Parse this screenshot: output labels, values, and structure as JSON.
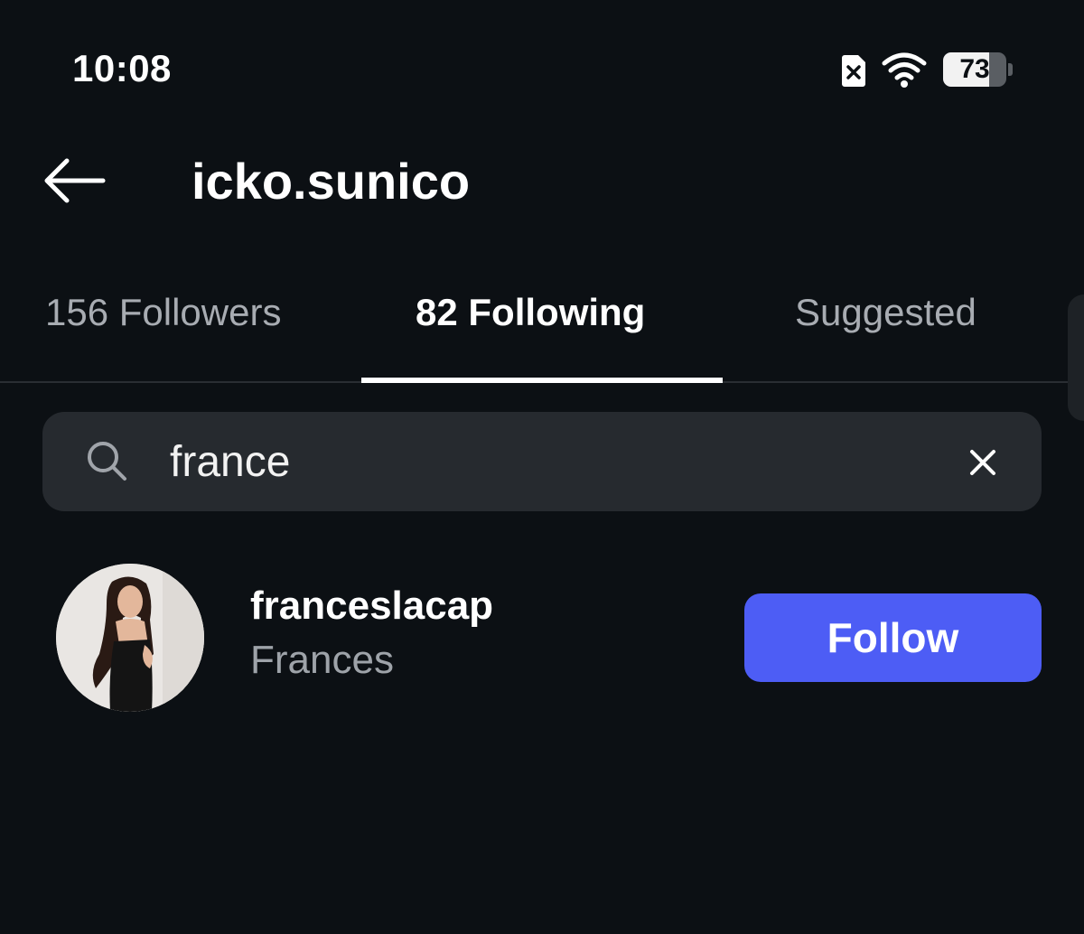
{
  "status_bar": {
    "time": "10:08",
    "battery_percent": 73,
    "battery_label": "73",
    "icons": [
      "sim-off-icon",
      "wifi-icon",
      "battery-icon"
    ]
  },
  "header": {
    "back_icon": "arrow-left-icon",
    "title": "icko.sunico"
  },
  "tabs": [
    {
      "label": "156 Followers",
      "active": false
    },
    {
      "label": "82 Following",
      "active": true
    },
    {
      "label": "Suggested",
      "active": false
    }
  ],
  "search": {
    "icon": "search-icon",
    "value": "france",
    "clear_icon": "close-icon"
  },
  "results": [
    {
      "username": "franceslacap",
      "full_name": "Frances",
      "button_label": "Follow"
    }
  ],
  "colors": {
    "background": "#0c1014",
    "search_bg": "#262a2f",
    "accent": "#4d5df5",
    "text_primary": "#ffffff",
    "text_secondary": "#9ea3a9"
  }
}
